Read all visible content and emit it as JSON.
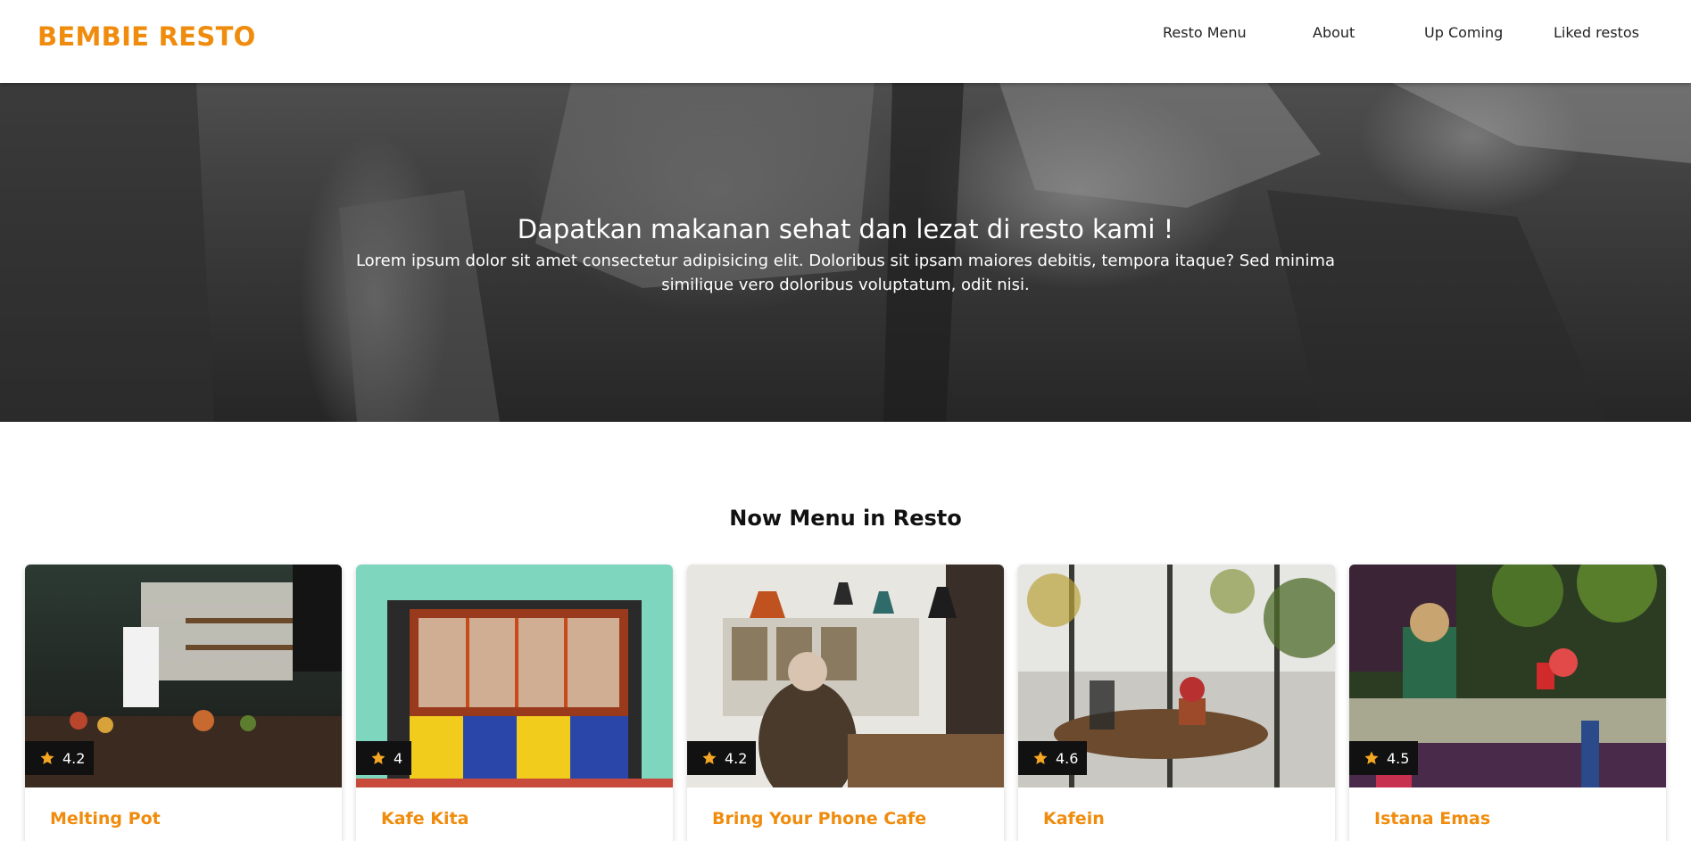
{
  "navbar": {
    "brand": "BEMBIE RESTO",
    "links": [
      {
        "label": "Resto Menu"
      },
      {
        "label": "About"
      },
      {
        "label": "Up Coming"
      },
      {
        "label": "Liked restos"
      }
    ]
  },
  "hero": {
    "title": "Dapatkan makanan sehat dan lezat di resto kami !",
    "subtitle": "Lorem ipsum dolor sit amet consectetur adipisicing elit. Doloribus sit ipsam maiores debitis, tempora itaque? Sed minima similique vero doloribus voluptatum, odit nisi."
  },
  "section": {
    "title": "Now Menu in Resto"
  },
  "restaurants": [
    {
      "name": "Melting Pot",
      "rating": "4.2",
      "icon": "star-icon"
    },
    {
      "name": "Kafe Kita",
      "rating": "4",
      "icon": "star-icon"
    },
    {
      "name": "Bring Your Phone Cafe",
      "rating": "4.2",
      "icon": "star-icon"
    },
    {
      "name": "Kafein",
      "rating": "4.6",
      "icon": "star-icon"
    },
    {
      "name": "Istana Emas",
      "rating": "4.5",
      "icon": "star-icon"
    }
  ],
  "colors": {
    "brand": "#f08c0d",
    "rating_badge": "#111111",
    "star": "#f5a623"
  }
}
